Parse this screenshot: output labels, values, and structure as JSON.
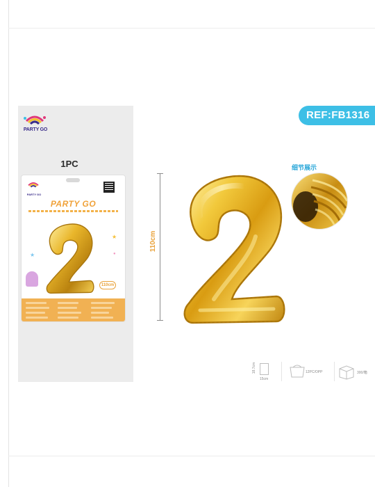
{
  "brand": {
    "name": "PARTY GO"
  },
  "package": {
    "quantity_label": "1PC",
    "title": "PARTY GO",
    "size_badge": "110cm"
  },
  "reference": {
    "label": "REF:FB1316"
  },
  "dimension": {
    "height_label": "110cm"
  },
  "detail": {
    "label": "细节展示"
  },
  "specs": {
    "box_size_vertical": "18.7cm",
    "box_size_horizontal": "15cm",
    "bag_count": "12PC/OPP",
    "carton_count": "300/箱"
  },
  "colors": {
    "gold": "#e9b62b",
    "ref_badge": "#3dbfe6",
    "accent_orange": "#e9a23a",
    "panel_gray": "#ececec"
  }
}
